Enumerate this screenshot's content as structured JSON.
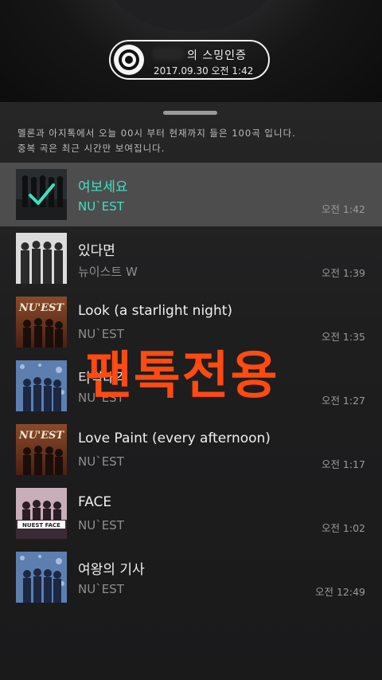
{
  "header": {
    "badge_title": "의 스밍인증",
    "badge_date": "2017.09.30 오전 1:42"
  },
  "sheet": {
    "info_line1": "멜론과 아지톡에서 오늘 00시 부터 현재까지 들은 100곡 입니다.",
    "info_line2": "중복 곡은 최근 시간만 보여집니다."
  },
  "songs": [
    {
      "title": "여보세요",
      "artist": "NU`EST",
      "time": "오전 1:42",
      "selected": true
    },
    {
      "title": "있다면",
      "artist": "뉴이스트 W",
      "time": "오전 1:39"
    },
    {
      "title": "Look (a starlight night)",
      "artist": "NU`EST",
      "time": "오전 1:35"
    },
    {
      "title": "티격태격",
      "artist": "NU`EST",
      "time": "오전 1:27"
    },
    {
      "title": "Love Paint (every afternoon)",
      "artist": "NU`EST",
      "time": "오전 1:17"
    },
    {
      "title": "FACE",
      "artist": "NU`EST",
      "time": "오전 1:02"
    },
    {
      "title": "여왕의 기사",
      "artist": "NU`EST",
      "time": "오전 12:49"
    }
  ],
  "album_art_text": {
    "nuest_logo": "NU'EST",
    "face_logo": "NUEST FACE"
  },
  "watermark": "팬톡전용",
  "colors": {
    "accent": "#3fe0c0",
    "watermark": "#ff4a12",
    "selected_row": "#4d4d4e"
  }
}
